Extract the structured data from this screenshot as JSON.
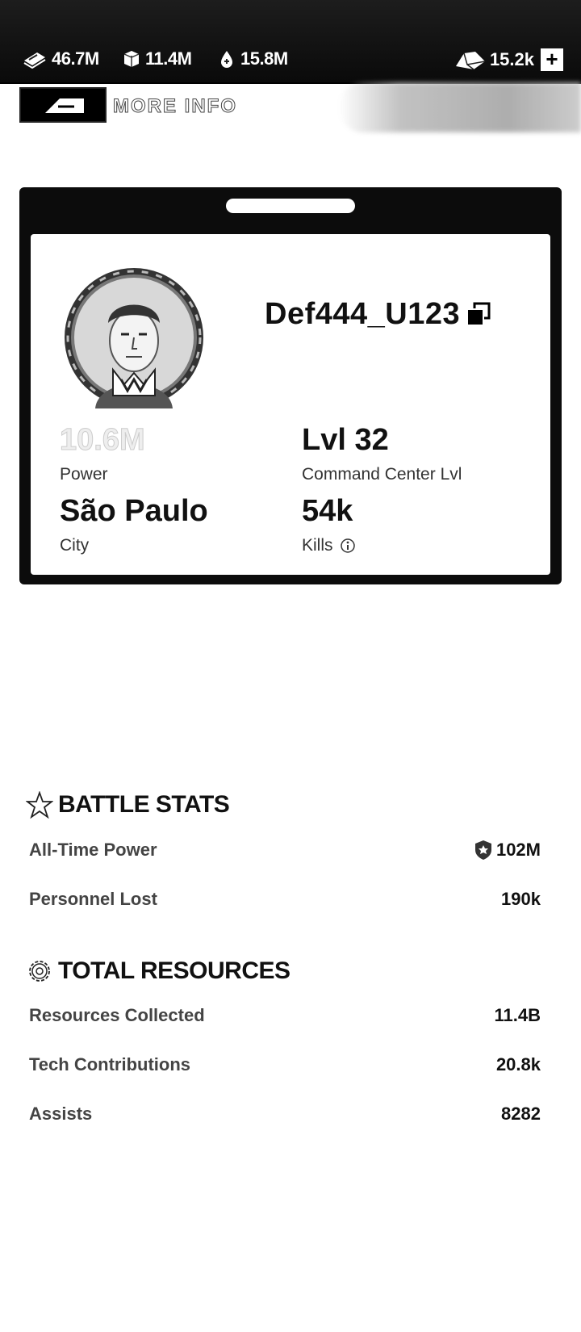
{
  "resources": {
    "cash": "46.7M",
    "supplies": "11.4M",
    "fuel": "15.8M",
    "premium": "15.2k",
    "add_label": "+"
  },
  "nav": {
    "more_info_label": "MORE INFO"
  },
  "profile": {
    "player_name": "Def444_U123",
    "power_value": "10.6M",
    "power_label": "Power",
    "cc_level_value": "Lvl 32",
    "cc_level_label": "Command Center Lvl",
    "city_value": "São Paulo",
    "city_label": "City",
    "kills_value": "54k",
    "kills_label": "Kills"
  },
  "battle_stats": {
    "title": "BATTLE STATS",
    "rows": [
      {
        "label": "All-Time Power",
        "value": "102M"
      },
      {
        "label": "Personnel Lost",
        "value": "190k"
      }
    ]
  },
  "total_resources": {
    "title": "TOTAL RESOURCES",
    "rows": [
      {
        "label": "Resources Collected",
        "value": "11.4B"
      },
      {
        "label": "Tech Contributions",
        "value": "20.8k"
      },
      {
        "label": "Assists",
        "value": "8282"
      }
    ]
  },
  "icons": {
    "cash": "cash-stack-icon",
    "supplies": "crate-icon",
    "fuel": "fuel-drop-icon",
    "premium": "gold-bars-icon",
    "copy": "copy-icon",
    "info": "info-icon",
    "star": "star-icon",
    "gear": "gear-icon",
    "shield": "shield-star-icon"
  },
  "colors": {
    "topbar": "#111111",
    "card_frame": "#0c0c0c",
    "text": "#111111"
  }
}
